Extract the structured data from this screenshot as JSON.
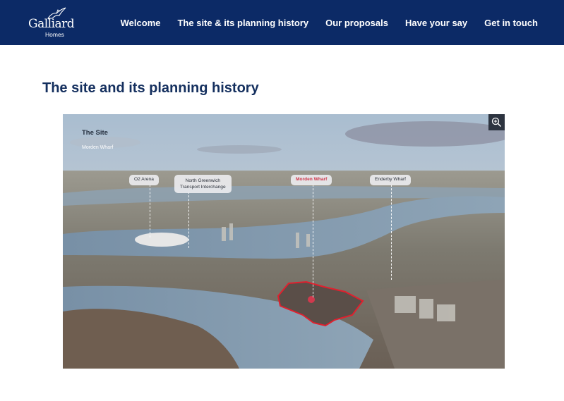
{
  "header": {
    "brand": {
      "name": "Galliard",
      "sub": "Homes"
    },
    "nav": [
      {
        "label": "Welcome"
      },
      {
        "label": "The site & its planning history"
      },
      {
        "label": "Our proposals"
      },
      {
        "label": "Have your say"
      },
      {
        "label": "Get in touch"
      }
    ]
  },
  "main": {
    "title": "The site and its planning history",
    "figure": {
      "heading": "The Site",
      "subheading": "Morden Wharf",
      "labels": [
        {
          "text": "O2 Arena"
        },
        {
          "text": "North Greenwich\nTransport Interchange"
        },
        {
          "text": "Morden Wharf"
        },
        {
          "text": "Enderby Wharf"
        }
      ],
      "zoom_icon": "zoom-in-icon"
    }
  },
  "colors": {
    "header_bg": "#0c2a66",
    "title": "#142f5e",
    "highlight": "#d0394d",
    "site_outline": "#e0202e"
  }
}
